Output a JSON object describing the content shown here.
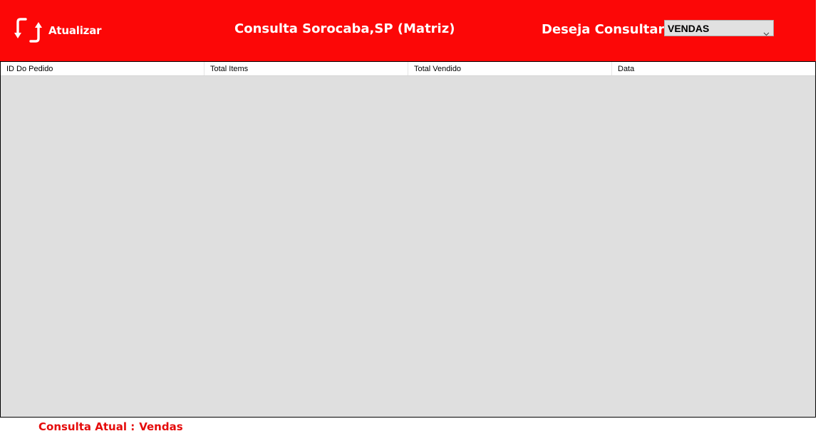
{
  "header": {
    "refresh_label": "Atualizar",
    "title": "Consulta Sorocaba,SP (Matriz)",
    "consult_label": "Deseja Consultar:",
    "consult_select": {
      "selected": "VENDAS"
    },
    "icons": {
      "refresh": "refresh-arrows-icon",
      "dropdown": "chevron-down-icon"
    }
  },
  "table": {
    "columns": [
      "ID Do Pedido",
      "Total Items",
      "Total Vendido",
      "Data"
    ],
    "rows": []
  },
  "status": {
    "label": "Consulta Atual :",
    "value": "Vendas"
  },
  "colors": {
    "header_bg": "#fc0707",
    "status_text": "#e50b0b",
    "grid_bg": "#dfdfdf"
  }
}
